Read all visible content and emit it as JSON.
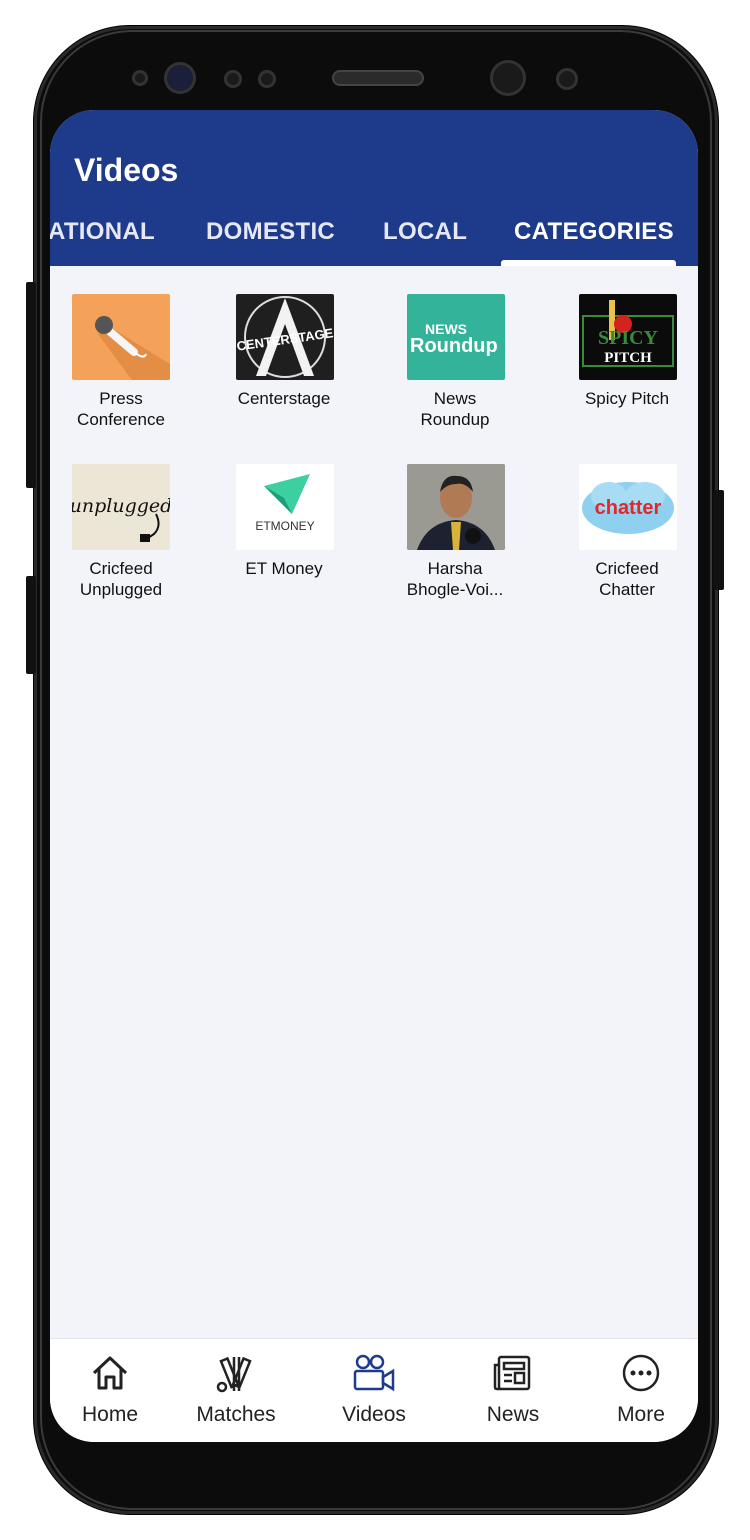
{
  "app": {
    "title": "Videos",
    "accent_color": "#1e3a8a"
  },
  "tabs": [
    {
      "label": "ATIONAL",
      "active": false
    },
    {
      "label": "DOMESTIC",
      "active": false
    },
    {
      "label": "LOCAL",
      "active": false
    },
    {
      "label": "CATEGORIES",
      "active": true
    }
  ],
  "categories": [
    {
      "line1": "Press",
      "line2": "Conference",
      "icon": "microphone-thumbnail"
    },
    {
      "line1": "Centerstage",
      "line2": "",
      "icon": "centerstage-thumbnail",
      "thumb_text": "CENTERSTAGE"
    },
    {
      "line1": "News",
      "line2": "Roundup",
      "icon": "news-roundup-thumbnail",
      "thumb_text_1": "NEWS",
      "thumb_text_2": "Roundup"
    },
    {
      "line1": "Spicy Pitch",
      "line2": "",
      "icon": "spicy-pitch-thumbnail",
      "thumb_text_1": "SPICY",
      "thumb_text_2": "PITCH"
    },
    {
      "line1": "Cricfeed",
      "line2": "Unplugged",
      "icon": "unplugged-thumbnail",
      "thumb_text": "unplugged"
    },
    {
      "line1": "ET Money",
      "line2": "",
      "icon": "et-money-thumbnail",
      "thumb_text": "ETMONEY"
    },
    {
      "line1": "Harsha",
      "line2": "Bhogle-Voi...",
      "icon": "harsha-photo-thumbnail"
    },
    {
      "line1": "Cricfeed",
      "line2": "Chatter",
      "icon": "chatter-thumbnail",
      "thumb_text": "chatter"
    }
  ],
  "bottom_nav": [
    {
      "label": "Home",
      "icon": "home-icon",
      "active": false
    },
    {
      "label": "Matches",
      "icon": "cricket-bats-icon",
      "active": false
    },
    {
      "label": "Videos",
      "icon": "video-camera-icon",
      "active": true
    },
    {
      "label": "News",
      "icon": "newspaper-icon",
      "active": false
    },
    {
      "label": "More",
      "icon": "more-dots-icon",
      "active": false
    }
  ]
}
